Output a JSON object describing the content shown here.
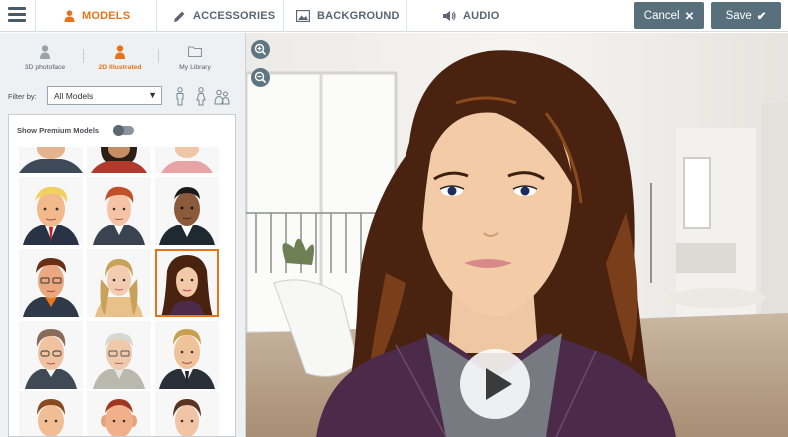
{
  "topbar": {
    "tabs": [
      {
        "label": "MODELS",
        "icon": "person-icon",
        "active": true
      },
      {
        "label": "ACCESSORIES",
        "icon": "pencil-icon",
        "active": false
      },
      {
        "label": "BACKGROUND",
        "icon": "image-icon",
        "active": false
      },
      {
        "label": "AUDIO",
        "icon": "speaker-icon",
        "active": false
      }
    ],
    "cancel_label": "Cancel",
    "save_label": "Save"
  },
  "sidebar": {
    "model_types": [
      {
        "label": "3D photoface",
        "active": false
      },
      {
        "label": "2D Illustrated",
        "active": true
      },
      {
        "label": "My Library",
        "active": false
      }
    ],
    "filter_label": "Filter by:",
    "filter_value": "All Models",
    "premium_label": "Show Premium Models",
    "premium_enabled": false
  },
  "colors": {
    "accent": "#e8731a",
    "button": "#58707c",
    "topbar_text": "#5b6670"
  }
}
